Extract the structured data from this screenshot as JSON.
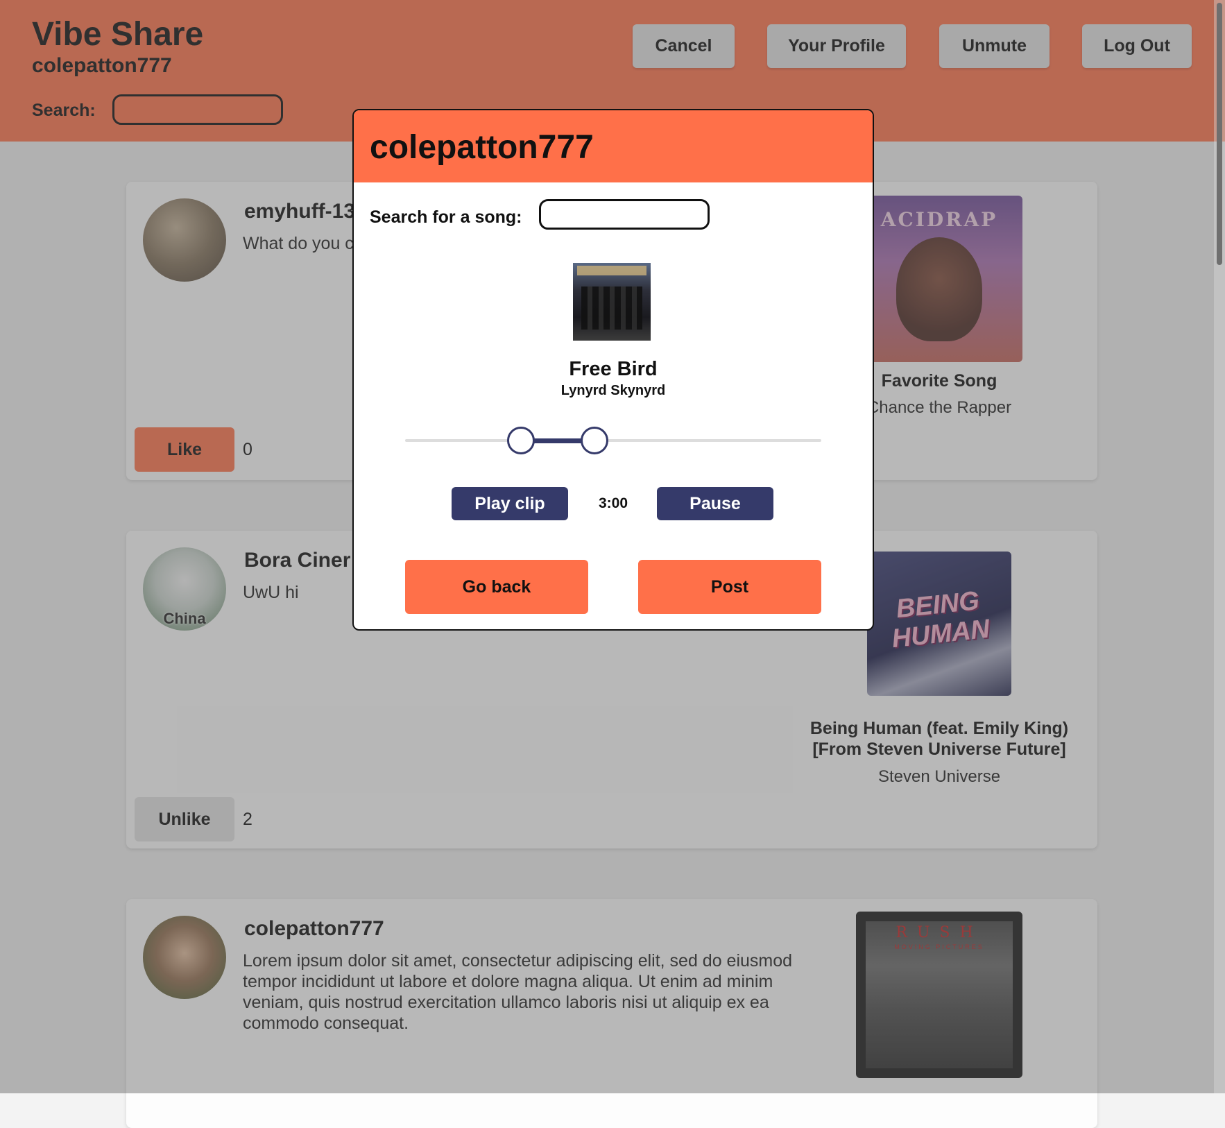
{
  "header": {
    "app_title": "Vibe Share",
    "username": "colepatton777",
    "search_label": "Search:",
    "search_value": "",
    "buttons": {
      "cancel": "Cancel",
      "profile": "Your Profile",
      "unmute": "Unmute",
      "logout": "Log Out"
    }
  },
  "colors": {
    "header_bg": "#ff7e5a",
    "modal_accent": "#ff7049",
    "primary_button": "#353a6a",
    "overlay": "rgba(70,70,70,0.38)"
  },
  "posts": [
    {
      "user": "emyhuff-13",
      "text": "What do you c",
      "like_label": "Like",
      "like_count": "0",
      "song_title": "Favorite Song",
      "song_artist": "Chance the Rapper",
      "album_label": "ACIDRAP"
    },
    {
      "user": "Bora Ciner",
      "text": "UwU hi",
      "avatar_caption": "China",
      "like_label": "Unlike",
      "like_count": "2",
      "song_title": "Being Human (feat. Emily King) [From Steven Universe Future]",
      "song_artist": "Steven Universe",
      "album_label": "BEING HUMAN"
    },
    {
      "user": "colepatton777",
      "text": "Lorem ipsum dolor sit amet, consectetur adipiscing elit, sed do eiusmod tempor incididunt ut labore et dolore magna aliqua. Ut enim ad minim veniam, quis nostrud exercitation ullamco laboris nisi ut aliquip ex ea commodo consequat.",
      "album_label": "RUSH",
      "album_sublabel": "MOVING PICTURES"
    }
  ],
  "modal": {
    "title": "colepatton777",
    "search_label": "Search for a song:",
    "search_value": "",
    "song": {
      "title": "Free Bird",
      "artist": "Lynyrd Skynyrd"
    },
    "clip_range": {
      "start_fraction": 0.25,
      "end_fraction": 0.43
    },
    "play_label": "Play clip",
    "time": "3:00",
    "pause_label": "Pause",
    "back_label": "Go back",
    "post_label": "Post"
  }
}
